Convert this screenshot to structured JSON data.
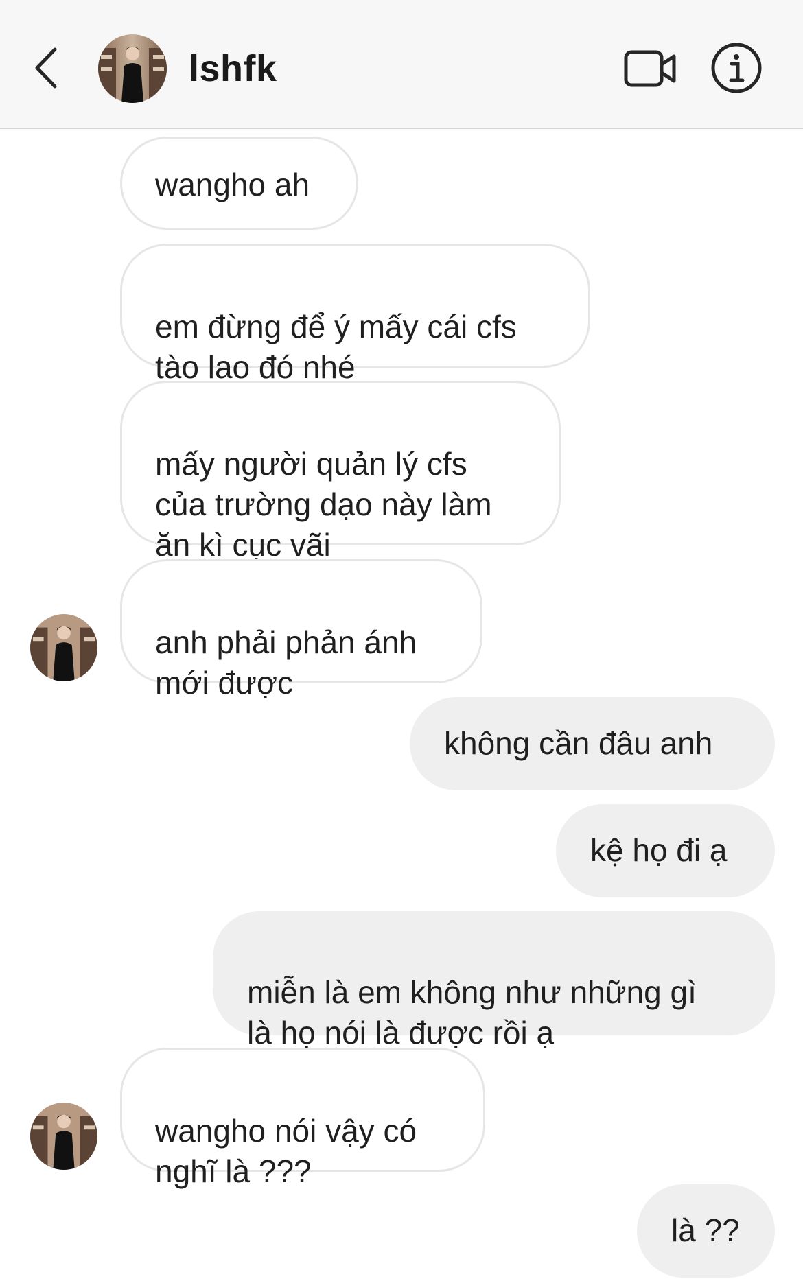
{
  "header": {
    "username": "lshfk",
    "back_icon": "chevron-left-icon",
    "video_icon": "video-camera-icon",
    "info_icon": "info-icon",
    "background": "#f7f7f7"
  },
  "messages": [
    {
      "from": "them",
      "text": "wangho ah"
    },
    {
      "from": "them",
      "text": "em đừng để ý mấy cái cfs\ntào lao đó nhé"
    },
    {
      "from": "them",
      "text": "mấy người quản lý cfs\ncủa trường dạo này làm\năn kì cục vãi"
    },
    {
      "from": "them",
      "text": "anh phải phản ánh\nmới được"
    },
    {
      "from": "me",
      "text": "không cần đâu anh"
    },
    {
      "from": "me",
      "text": "kệ họ đi ạ"
    },
    {
      "from": "me",
      "text": "miễn là em không như những gì\nlà họ nói là được rồi ạ"
    },
    {
      "from": "them",
      "text": "wangho nói vậy có\nnghĩ là ???"
    },
    {
      "from": "me",
      "text": "là ??"
    }
  ],
  "colors": {
    "incoming_bubble_border": "#e6e6e6",
    "outgoing_bubble_bg": "#efefef",
    "text": "#1f1f1f"
  }
}
